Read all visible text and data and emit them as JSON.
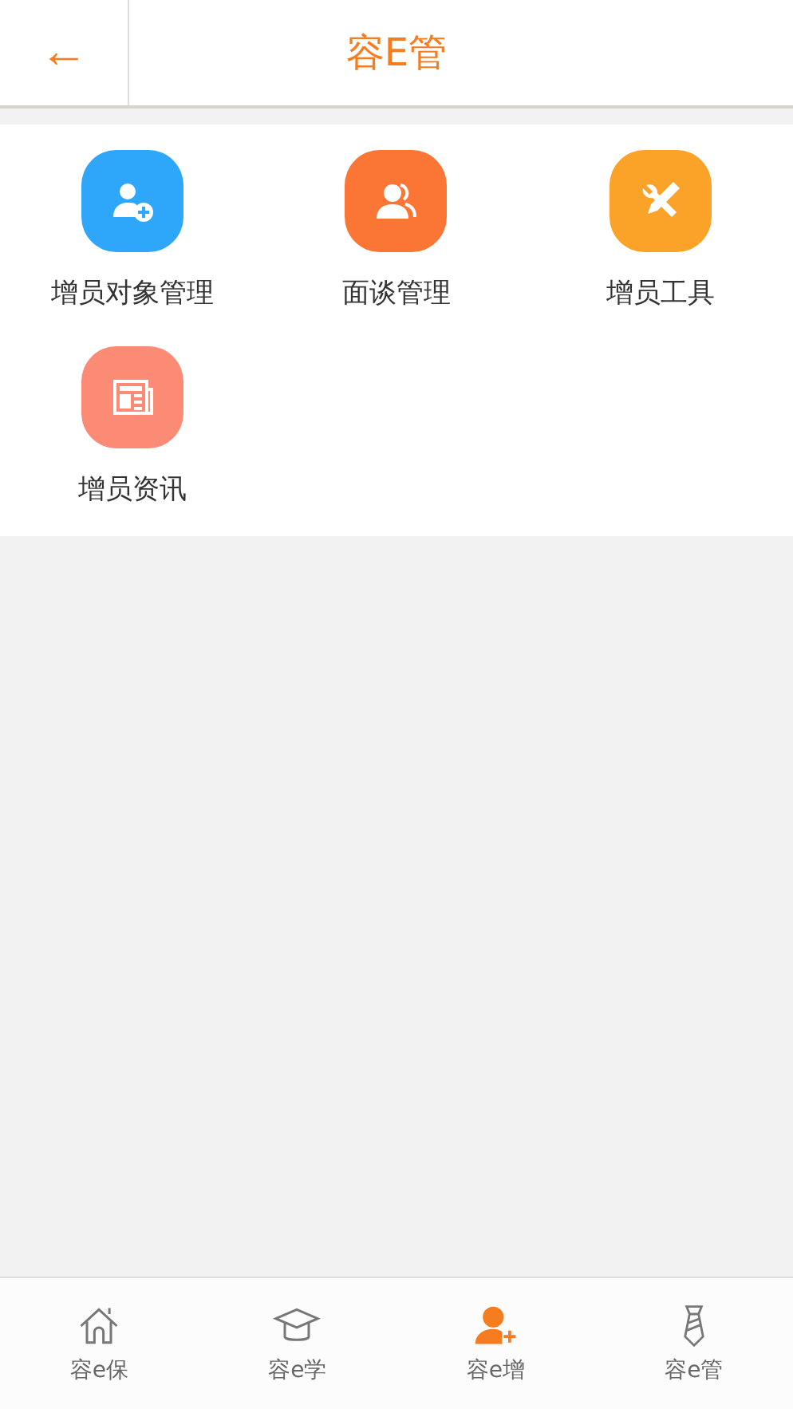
{
  "header": {
    "back": "←",
    "title": "容E管"
  },
  "menu": [
    {
      "label": "增员对象管理",
      "kind": "person-add",
      "color": "#2ea7fb"
    },
    {
      "label": "面谈管理",
      "kind": "people",
      "color": "#fb7634"
    },
    {
      "label": "增员工具",
      "kind": "tools",
      "color": "#fba228"
    },
    {
      "label": "增员资讯",
      "kind": "news",
      "color": "#fc8b76"
    }
  ],
  "tabs": [
    {
      "label": "容e保",
      "kind": "home",
      "selected": false
    },
    {
      "label": "容e学",
      "kind": "cap",
      "selected": false
    },
    {
      "label": "容e增",
      "kind": "person-add",
      "selected": true
    },
    {
      "label": "容e管",
      "kind": "tie",
      "selected": false
    }
  ]
}
